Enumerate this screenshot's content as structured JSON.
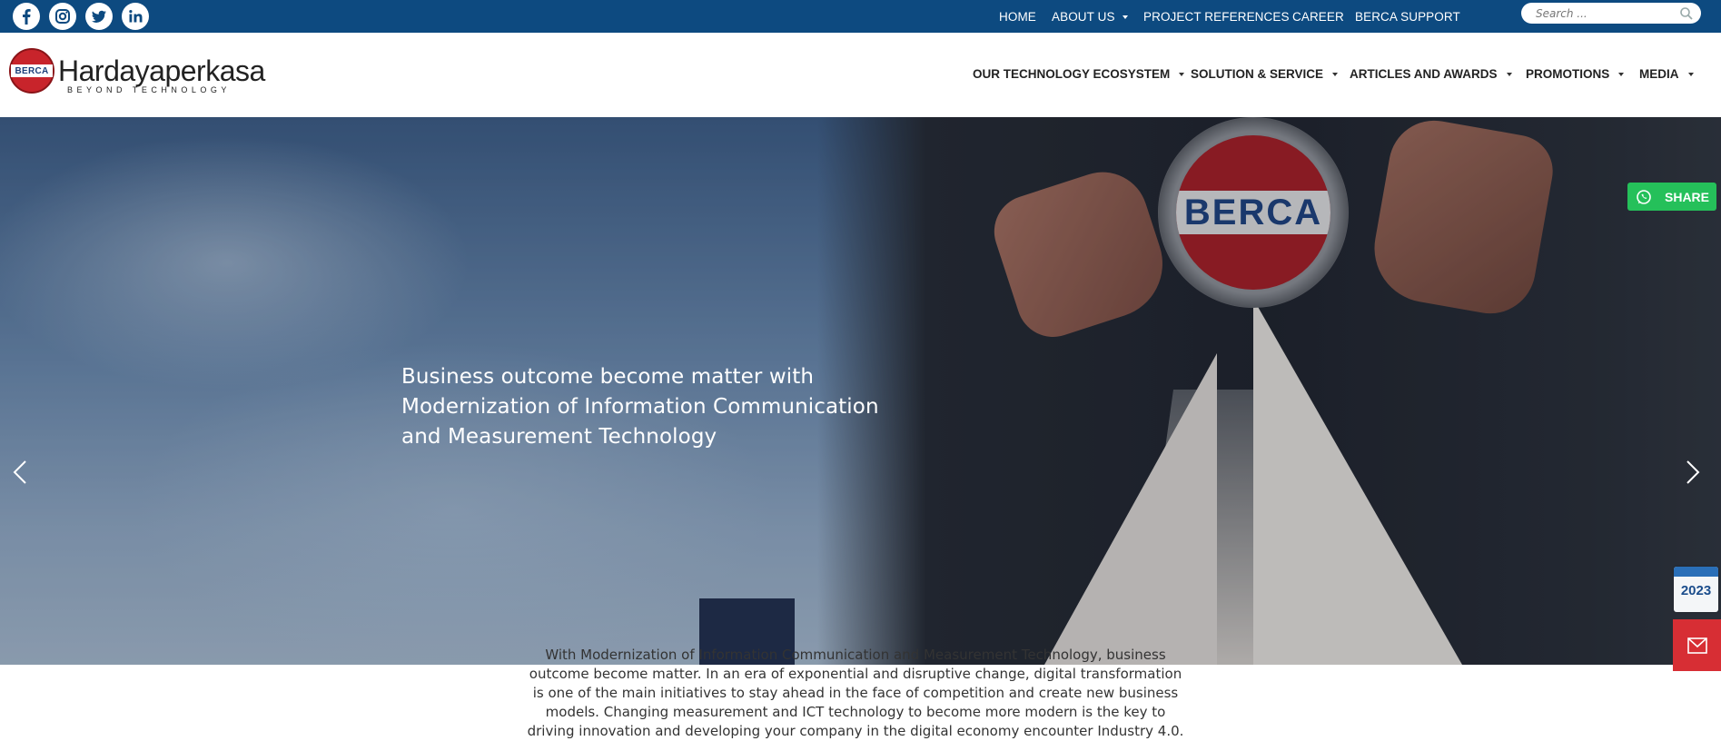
{
  "social": {
    "facebook": "facebook-icon",
    "instagram": "instagram-icon",
    "twitter": "twitter-icon",
    "linkedin": "linkedin-icon"
  },
  "topnav": {
    "home": "HOME",
    "about": "ABOUT US",
    "references": "PROJECT REFERENCES",
    "career": "CAREER",
    "support": "BERCA SUPPORT"
  },
  "search": {
    "placeholder": "Search ..."
  },
  "logo": {
    "badge_text": "BERCA",
    "brand": "Hardayaperkasa",
    "tagline": "BEYOND TECHNOLOGY"
  },
  "mainnav": {
    "ecosystem": "OUR TECHNOLOGY ECOSYSTEM",
    "solution": "SOLUTION & SERVICE",
    "articles": "ARTICLES AND AWARDS",
    "promotions": "PROMOTIONS",
    "media": "MEDIA"
  },
  "hero": {
    "badge_text": "BERCA",
    "headline": "Business outcome become matter with Modernization of Information Communication and Measurement Technology"
  },
  "widgets": {
    "share_label": "SHARE",
    "calendar_year": "2023"
  },
  "intro": {
    "text": "With Modernization of Information Communication and Measurement Technology, business outcome become matter. In an era of exponential and disruptive change, digital transformation is one of the main initiatives to stay ahead in the face of competition and create new business models. Changing measurement and ICT technology to become more modern is the key to driving innovation and developing your company in the digital economy encounter Industry 4.0."
  },
  "colors": {
    "topbar": "#0d4a80",
    "brand_red": "#c8242b",
    "share_green": "#25c05a",
    "mail_red": "#d72e34"
  }
}
